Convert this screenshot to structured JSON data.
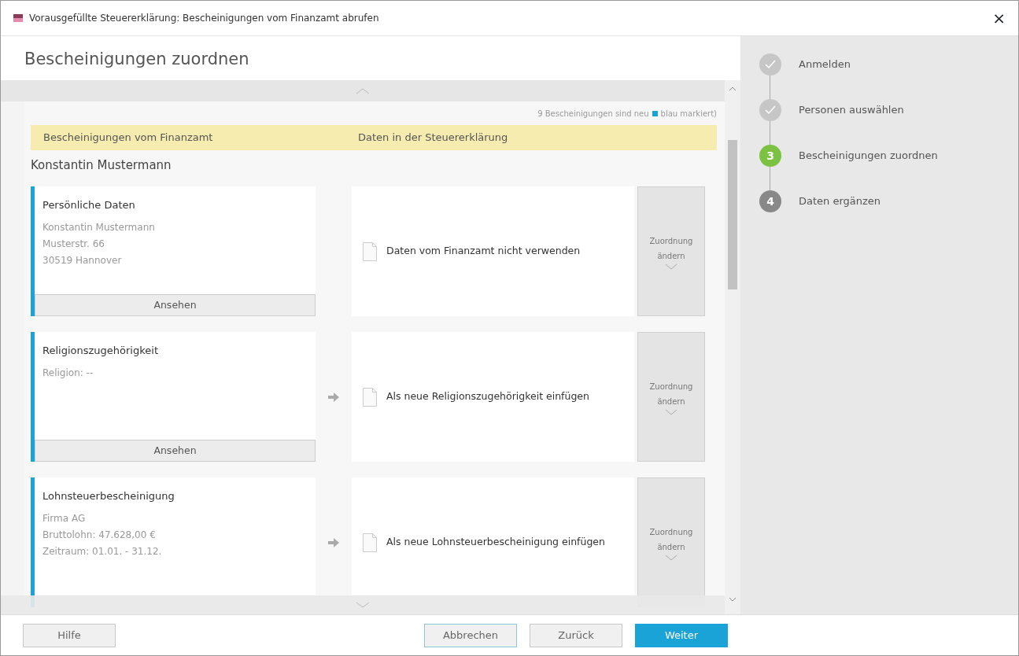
{
  "window": {
    "title": "Vorausgefüllte Steuererklärung: Bescheinigungen vom Finanzamt abrufen",
    "close": "×"
  },
  "heading": "Bescheinigungen zuordnen",
  "notice": {
    "before": "9 Bescheinigungen sind neu",
    "marker": {
      "color": "#1aa3d6"
    },
    "after": "blau markiert)"
  },
  "columns": [
    "Bescheinigungen vom Finanzamt",
    "Daten in der Steuererklärung"
  ],
  "person": "Konstantin Mustermann",
  "rows": [
    {
      "title": "Persönliche Daten",
      "lines": [
        "Konstantin Mustermann",
        "Musterstr. 66",
        "30519 Hannover"
      ],
      "new": true,
      "view_button": "Ansehen",
      "arrow": false,
      "target": "Daten vom Finanzamt nicht verwenden",
      "change_button": [
        "Zuordnung",
        "ändern"
      ]
    },
    {
      "title": "Religionszugehörigkeit",
      "lines": [
        "Religion: --"
      ],
      "new": true,
      "view_button": "Ansehen",
      "arrow": true,
      "target": "Als neue Religionszugehörigkeit einfügen",
      "change_button": [
        "Zuordnung",
        "ändern"
      ]
    },
    {
      "title": "Lohnsteuerbescheinigung",
      "lines": [
        "Firma AG",
        "Bruttolohn: 47.628,00 €",
        "Zeitraum: 01.01. - 31.12."
      ],
      "new": true,
      "arrow": true,
      "target": "Als neue Lohnsteuerbescheinigung einfügen",
      "change_button": [
        "Zuordnung",
        "ändern"
      ]
    }
  ],
  "steps": [
    {
      "label": "Anmelden",
      "kind": "done"
    },
    {
      "label": "Personen auswählen",
      "kind": "done"
    },
    {
      "number": "3",
      "label": "Bescheinigungen zuordnen",
      "kind": "current"
    },
    {
      "number": "4",
      "label": "Daten ergänzen",
      "kind": "pending"
    }
  ],
  "footer": {
    "help": "Hilfe",
    "cancel": "Abbrechen",
    "back": "Zurück",
    "next": "Weiter"
  }
}
